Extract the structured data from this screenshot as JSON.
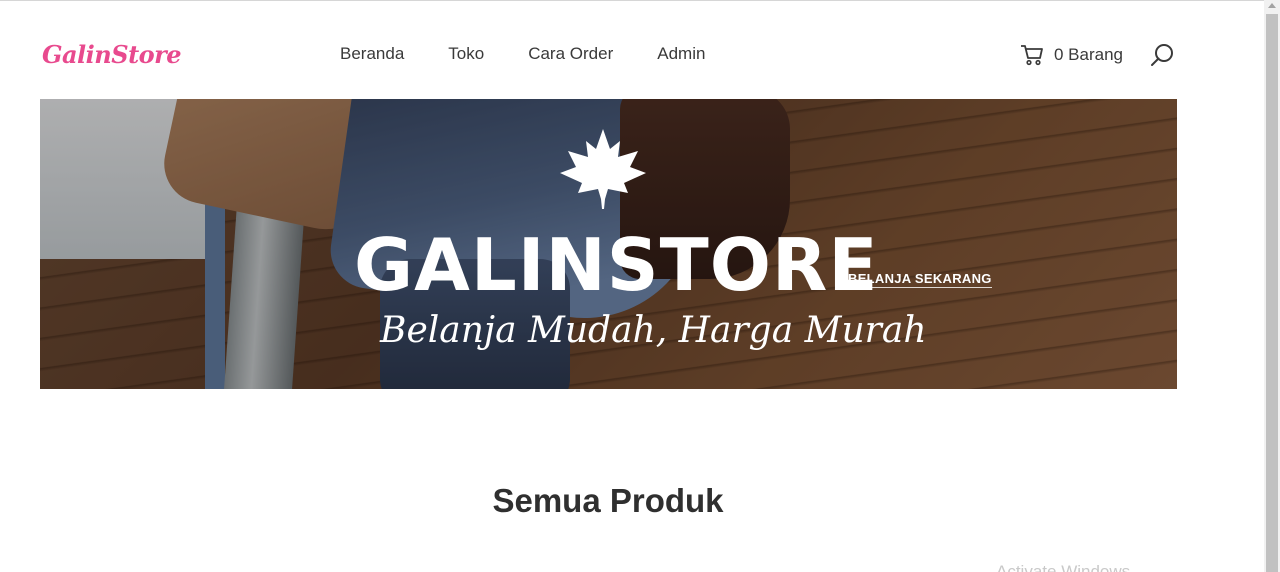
{
  "header": {
    "logo_text": "GalinStore",
    "nav": [
      "Beranda",
      "Toko",
      "Cara Order",
      "Admin"
    ],
    "cart_label": "0 Barang",
    "cart_icon": "cart-icon",
    "search_icon": "search-icon"
  },
  "hero": {
    "title": "GALINSTORE",
    "subtitle": "Belanja Mudah, Harga Murah",
    "cta_label": "BELANJA SEKARANG",
    "emblem_icon": "maple-leaf-icon"
  },
  "main": {
    "section_title": "Semua Produk"
  },
  "overlay": {
    "watermark_text": "Activate Windows"
  },
  "colors": {
    "logo": "#e84a8e",
    "text": "#3a3a3a",
    "hero_text": "#ffffff"
  }
}
